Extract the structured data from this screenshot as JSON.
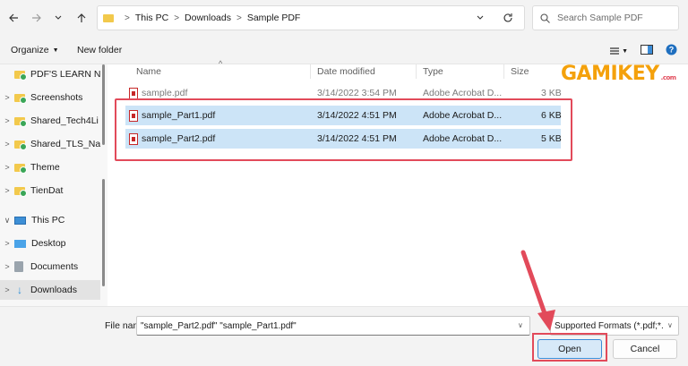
{
  "address": {
    "breadcrumb": [
      "This PC",
      "Downloads",
      "Sample PDF"
    ],
    "search_placeholder": "Search Sample PDF"
  },
  "commands": {
    "organize": "Organize",
    "new_folder": "New folder"
  },
  "sidebar": {
    "items": [
      {
        "label": "PDF'S LEARN N"
      },
      {
        "label": "Screenshots"
      },
      {
        "label": "Shared_Tech4Li"
      },
      {
        "label": "Shared_TLS_Na"
      },
      {
        "label": "Theme"
      },
      {
        "label": "TienDat"
      },
      {
        "label": "This PC"
      },
      {
        "label": "Desktop"
      },
      {
        "label": "Documents"
      },
      {
        "label": "Downloads"
      }
    ]
  },
  "columns": {
    "name": "Name",
    "date": "Date modified",
    "type": "Type",
    "size": "Size"
  },
  "files": [
    {
      "name": "sample.pdf",
      "date": "3/14/2022 3:54 PM",
      "type": "Adobe Acrobat D...",
      "size": "3 KB"
    },
    {
      "name": "sample_Part1.pdf",
      "date": "3/14/2022 4:51 PM",
      "type": "Adobe Acrobat D...",
      "size": "6 KB"
    },
    {
      "name": "sample_Part2.pdf",
      "date": "3/14/2022 4:51 PM",
      "type": "Adobe Acrobat D...",
      "size": "5 KB"
    }
  ],
  "footer": {
    "file_name_label": "File name:",
    "file_name_value": "\"sample_Part2.pdf\" \"sample_Part1.pdf\"",
    "filter": "Supported Formats (*.pdf;*.",
    "open": "Open",
    "cancel": "Cancel"
  },
  "logo": {
    "text": "GAMIKEY",
    "suffix": ".com"
  },
  "colors": {
    "accent": "#3b8bd6",
    "selection": "#cce4f7",
    "annotation": "#e24a5a",
    "logo": "#f4a10b"
  }
}
